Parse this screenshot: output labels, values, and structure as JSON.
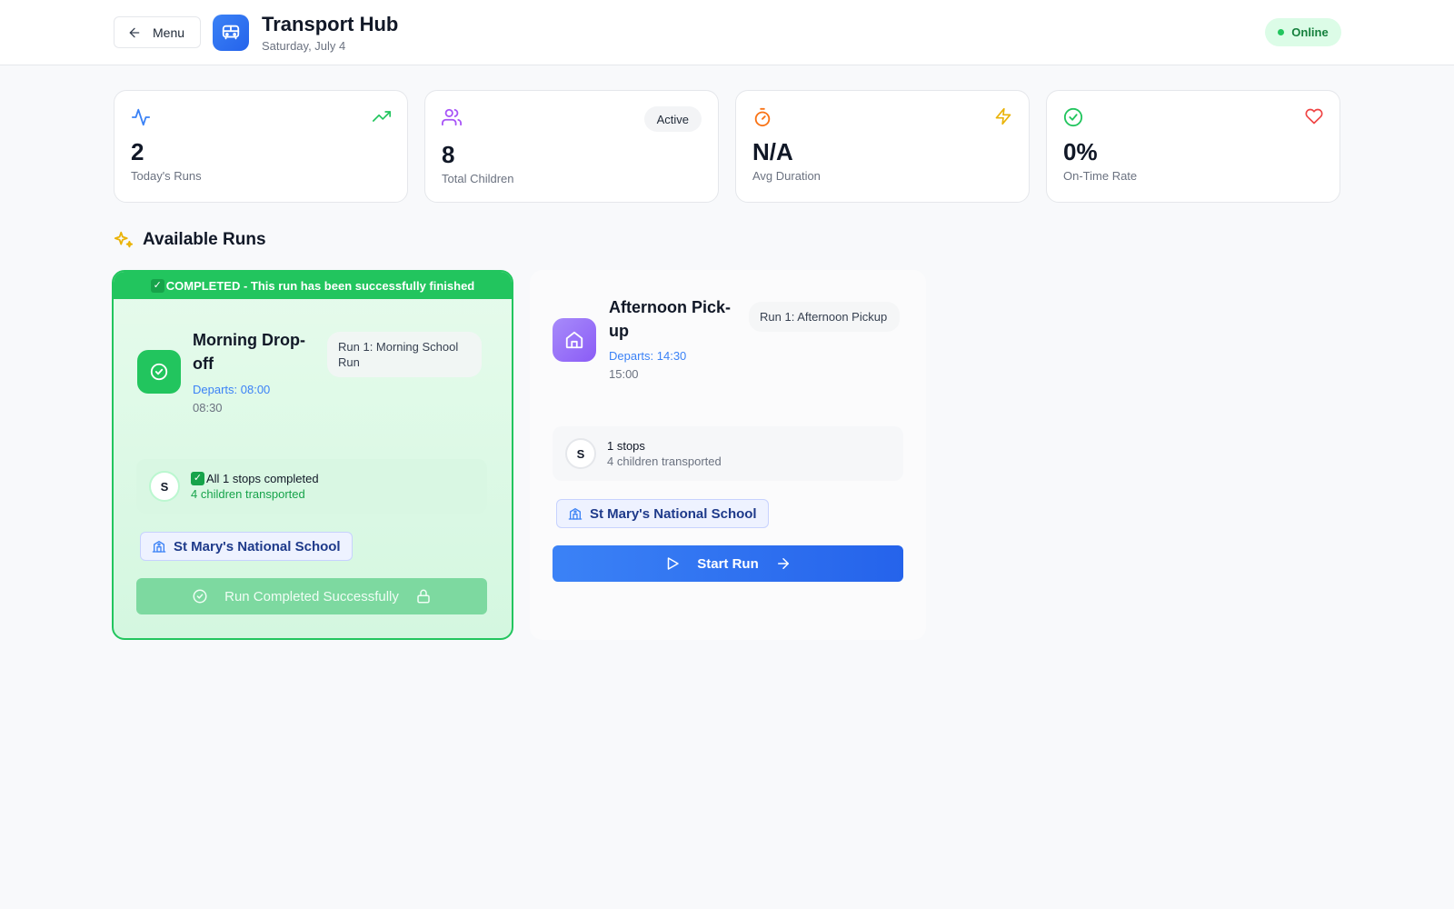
{
  "header": {
    "menu_label": "Menu",
    "title": "Transport Hub",
    "date": "Saturday, July 4",
    "status": "Online"
  },
  "stats": [
    {
      "value": "2",
      "label": "Today's Runs",
      "icon_left": "activity-icon",
      "icon_right": "trending-up-icon"
    },
    {
      "value": "8",
      "label": "Total Children",
      "badge": "Active",
      "icon_left": "users-icon"
    },
    {
      "value": "N/A",
      "label": "Avg Duration",
      "icon_left": "timer-icon",
      "icon_right": "zap-icon"
    },
    {
      "value": "0%",
      "label": "On-Time Rate",
      "icon_left": "check-circle-icon",
      "icon_right": "heart-icon"
    }
  ],
  "section": {
    "title": "Available Runs",
    "icon": "sparkles-icon"
  },
  "runs": [
    {
      "banner": "COMPLETED - This run has been successfully finished",
      "name": "Morning Drop-off",
      "tag": "Run 1: Morning School Run",
      "departs": "Departs: 08:00",
      "arrives": "08:30",
      "stop_initial": "S",
      "stops_text": "All 1 stops completed",
      "children_text": "4 children transported",
      "school": "St Mary's National School",
      "button": "Run Completed Successfully",
      "icon": "check-circle-icon"
    },
    {
      "name": "Afternoon Pick-up",
      "tag": "Run 1: Afternoon Pickup",
      "departs": "Departs: 14:30",
      "arrives": "15:00",
      "stop_initial": "S",
      "stops_text": "1 stops",
      "children_text": "4 children transported",
      "school": "St Mary's National School",
      "button": "Start Run",
      "icon": "home-icon"
    }
  ],
  "colors": {
    "primary": "#3b82f6",
    "success": "#22c55e",
    "purple": "#8b5cf6",
    "orange": "#f97316"
  }
}
